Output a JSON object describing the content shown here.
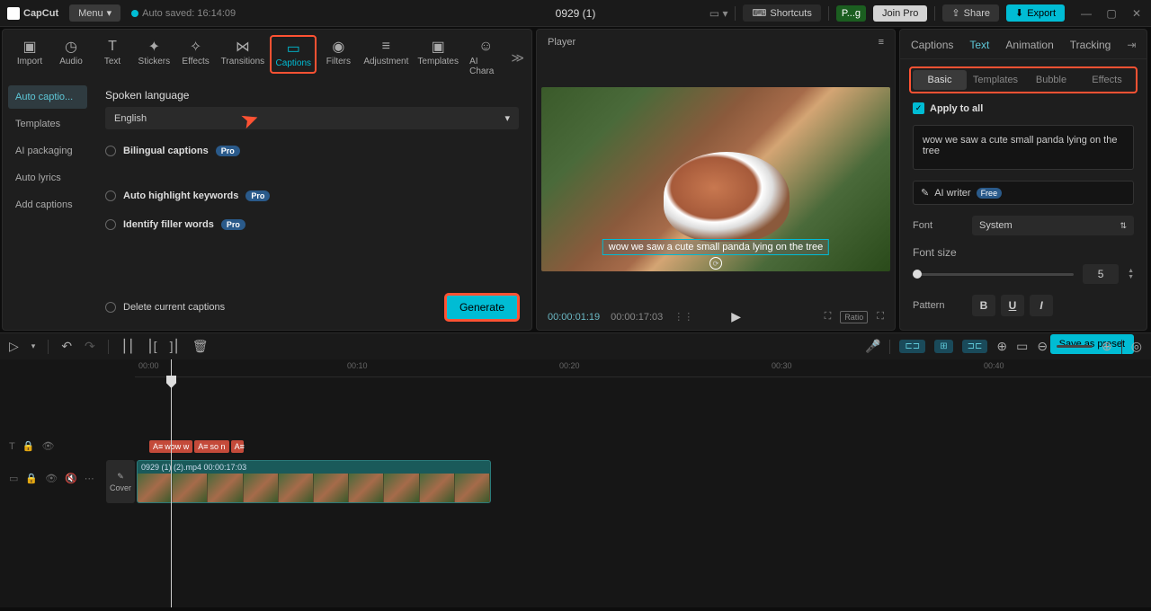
{
  "app": {
    "name": "CapCut",
    "menu": "Menu",
    "autosave": "Auto saved: 16:14:09",
    "project": "0929 (1)"
  },
  "titleActions": {
    "shortcuts": "Shortcuts",
    "user": "P...g",
    "joinpro": "Join Pro",
    "share": "Share",
    "export": "Export"
  },
  "toolTabs": [
    "Import",
    "Audio",
    "Text",
    "Stickers",
    "Effects",
    "Transitions",
    "Captions",
    "Filters",
    "Adjustment",
    "Templates",
    "AI Chara"
  ],
  "captionSidebar": [
    "Auto captio...",
    "Templates",
    "AI packaging",
    "Auto lyrics",
    "Add captions"
  ],
  "captionsPanel": {
    "spokenLangLabel": "Spoken language",
    "spokenLang": "English",
    "bilingual": "Bilingual captions",
    "highlight": "Auto highlight keywords",
    "filler": "Identify filler words",
    "deleteCurrent": "Delete current captions",
    "generate": "Generate"
  },
  "player": {
    "title": "Player",
    "captionText": "wow we saw a cute small panda lying on the tree",
    "currentTime": "00:00:01:19",
    "totalTime": "00:00:17:03",
    "ratio": "Ratio"
  },
  "rightPanel": {
    "tabs": [
      "Captions",
      "Text",
      "Animation",
      "Tracking"
    ],
    "subtabs": [
      "Basic",
      "Templates",
      "Bubble",
      "Effects"
    ],
    "applyAll": "Apply to all",
    "captionText": "wow we saw a cute small panda lying on the tree",
    "aiWriter": "AI writer",
    "aiWriterBadge": "Free",
    "fontLabel": "Font",
    "fontValue": "System",
    "fontSizeLabel": "Font size",
    "fontSizeValue": "5",
    "patternLabel": "Pattern",
    "savePreset": "Save as preset"
  },
  "timeline": {
    "marks": [
      "00:00",
      "00:10",
      "00:20",
      "00:30",
      "00:40"
    ],
    "coverLabel": "Cover",
    "videoLabel": "0929 (1) (2).mp4   00:00:17:03",
    "capClips": [
      "wow w",
      "so n",
      ""
    ]
  }
}
